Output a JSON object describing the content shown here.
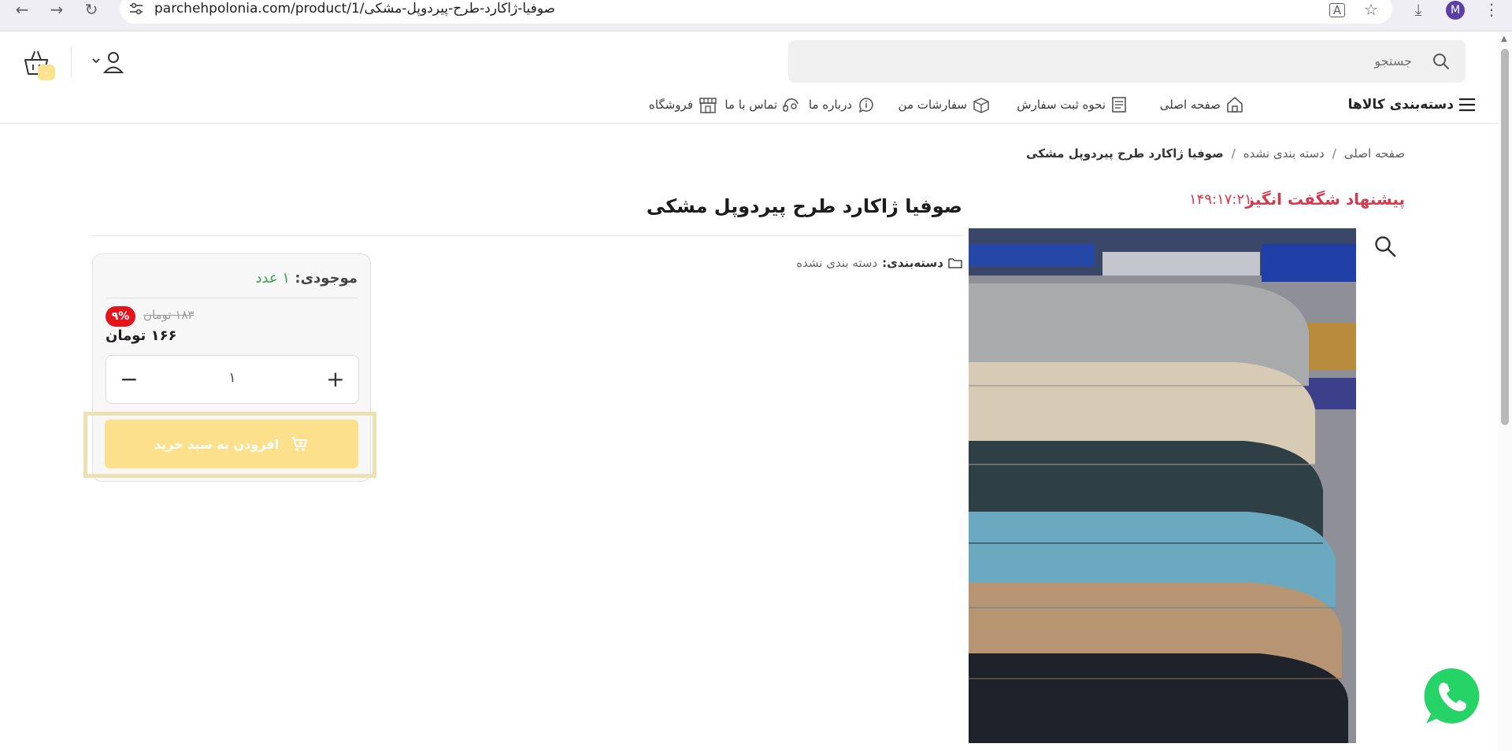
{
  "browser": {
    "url": "parchehpolonia.com/product/1/صوفیا-ژاکارد-طرح-پیردوپل-مشکی",
    "profile_initial": "M",
    "icons": [
      "back-icon",
      "forward-icon",
      "reload-icon",
      "site-info-icon",
      "translate-icon",
      "bookmark-star-icon",
      "download-icon",
      "menu-icon"
    ]
  },
  "header": {
    "search_placeholder": "جستجو",
    "cart_count": "۰"
  },
  "nav": {
    "categories": "دسته‌بندی کالاها",
    "items": [
      {
        "label": "صفحه اصلی",
        "icon": "home-icon"
      },
      {
        "label": "نحوه ثبت سفارش",
        "icon": "receipt-icon"
      },
      {
        "label": "سفارشات من",
        "icon": "box-icon"
      },
      {
        "label": "درباره ما",
        "icon": "info-icon"
      },
      {
        "label": "تماس با ما",
        "icon": "headset-icon"
      },
      {
        "label": "فروشگاه",
        "icon": "store-icon"
      }
    ]
  },
  "breadcrumb": {
    "home": "صفحه اصلی",
    "category": "دسته بندی نشده",
    "current": "صوفیا ژاکارد طرح پیردوپل مشکی"
  },
  "product": {
    "offer_label": "پیشنهاد شگفت انگیز",
    "countdown": "۱۴۹:۱۷:۲۱",
    "title": "صوفیا ژاکارد طرح پیردوپل مشکی",
    "category_label": "دسته‌بندی:",
    "category_value": "دسته بندی نشده",
    "image_stack_colors": [
      "#a9aaab",
      "#d8cbb6",
      "#2e3f46",
      "#6aa9bf",
      "#b89572",
      "#1e232b"
    ]
  },
  "buybox": {
    "stock_label": "موجودی:",
    "stock_value": "۱ عدد",
    "old_price": "۱۸۳ تومان",
    "discount": "۹%",
    "new_price": "۱۶۶ تومان",
    "quantity": "۱",
    "add_to_cart": "افزودن به سبد خرید",
    "button_color": "#fde08c",
    "discount_color": "#e3141b"
  },
  "colors": {
    "accent_red": "#d43a4d",
    "stock_green": "#39a04a",
    "whatsapp": "#25d366"
  }
}
